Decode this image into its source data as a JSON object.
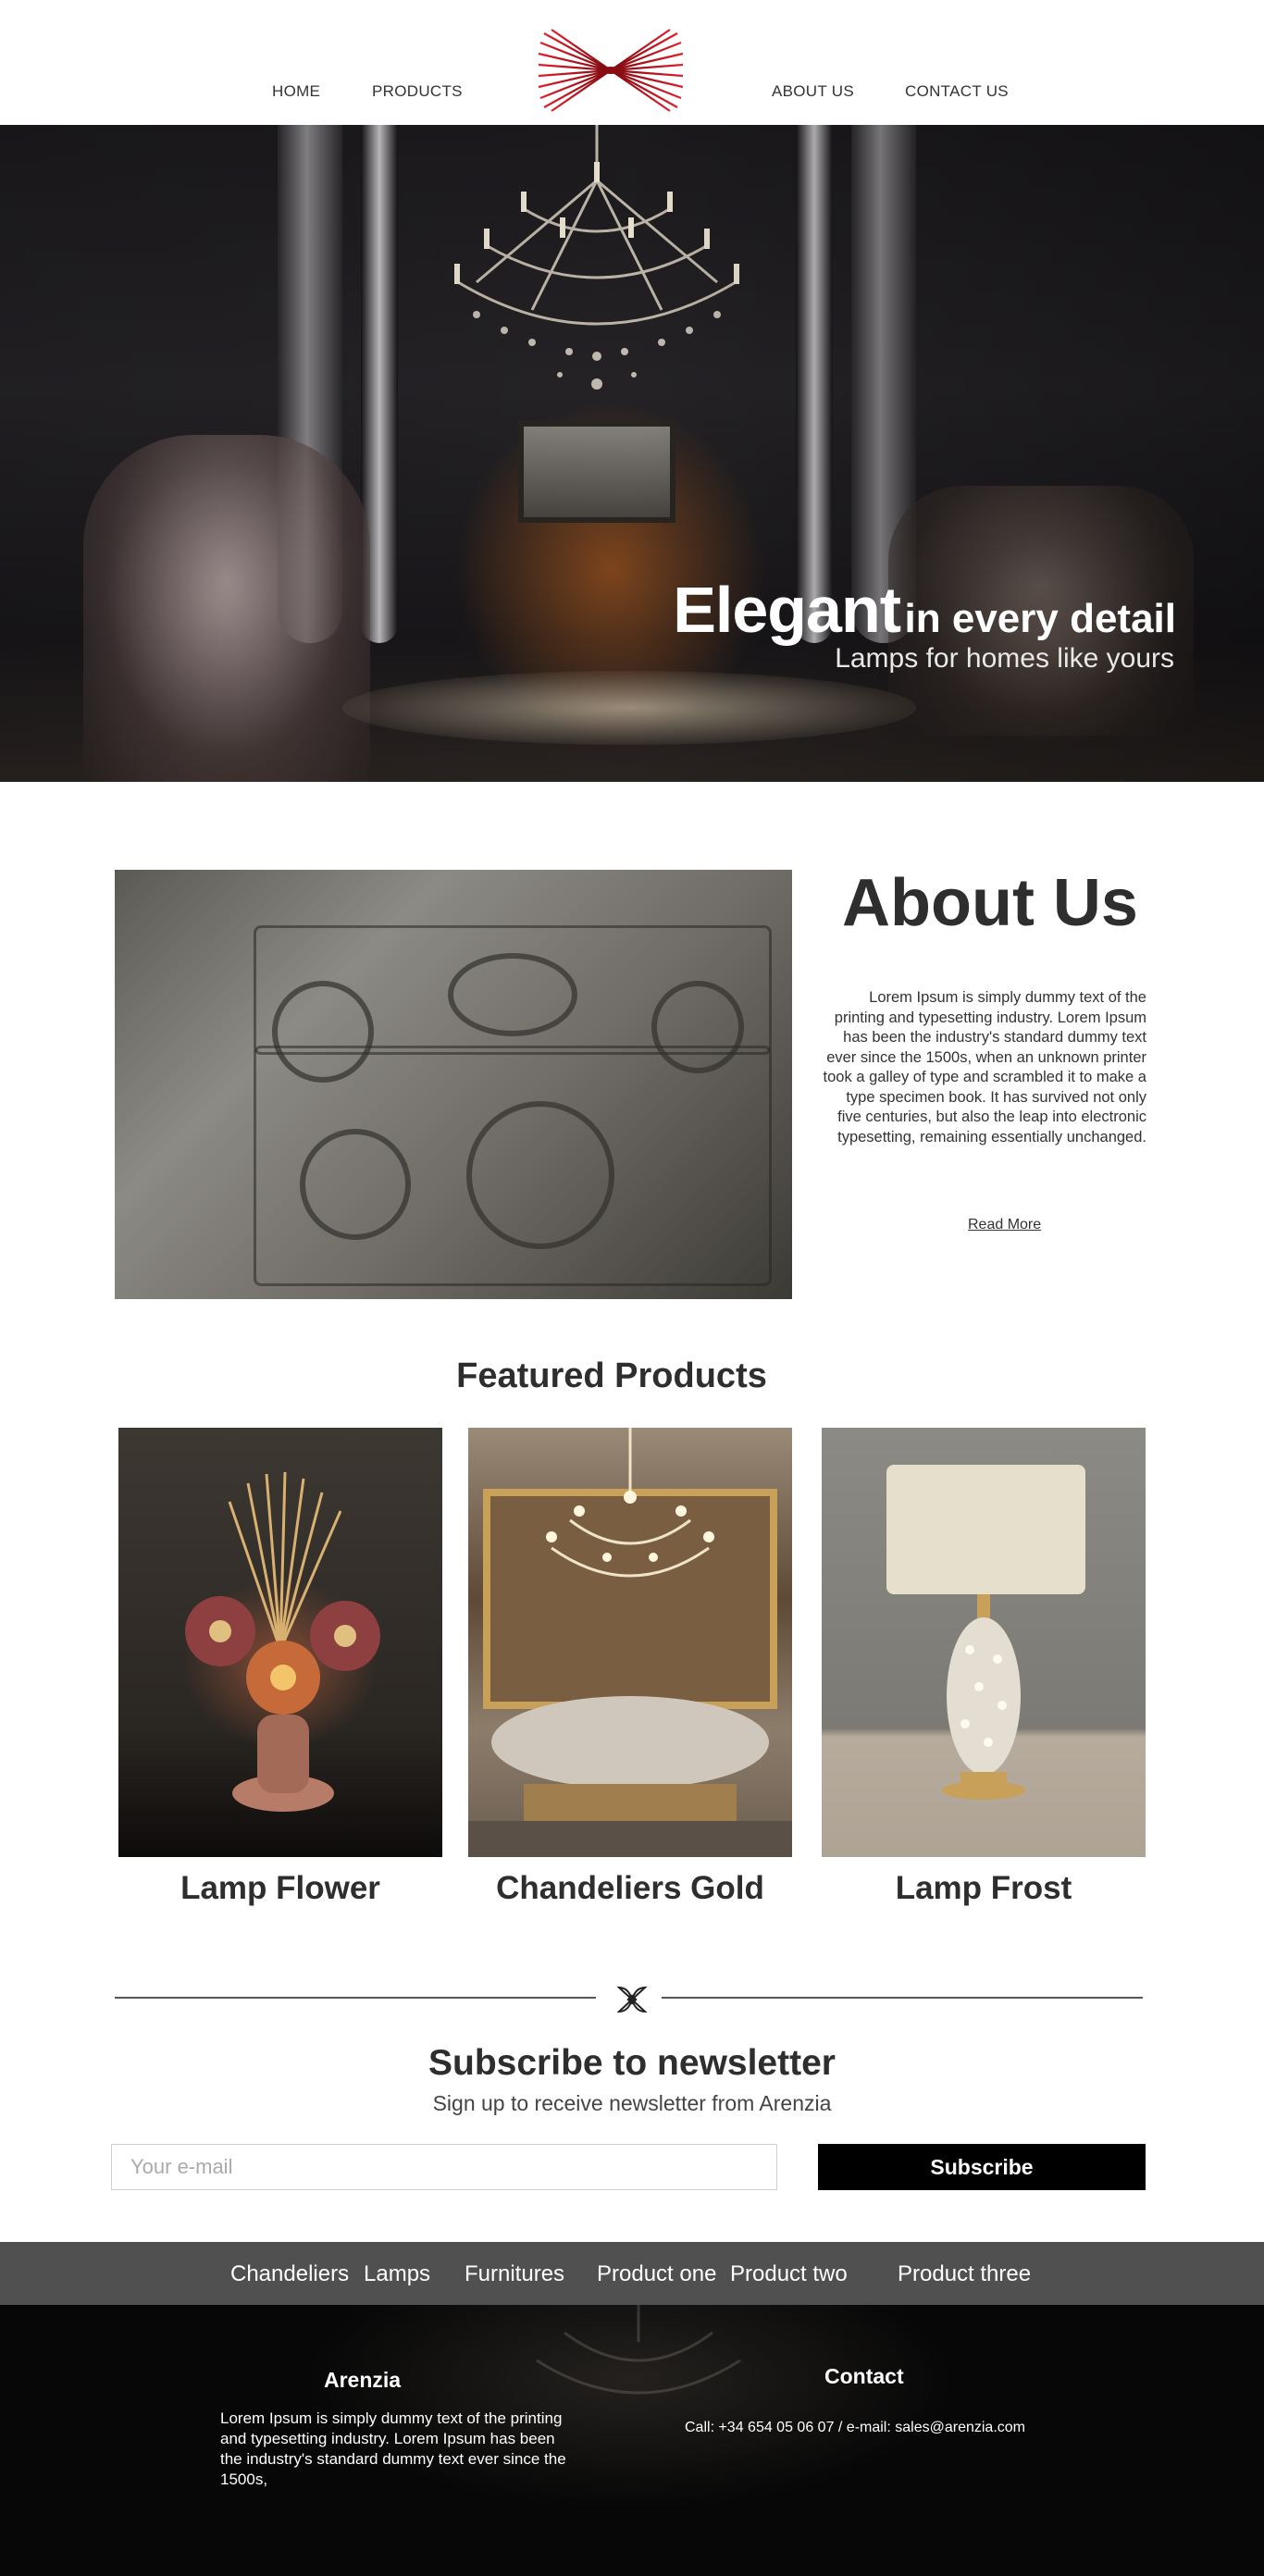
{
  "header": {
    "nav_left": [
      "HOME",
      "PRODUCTS"
    ],
    "nav_right": [
      "ABOUT US",
      "CONTACT US"
    ],
    "logo_icon": "bow-tie-rays-logo",
    "logo_color": "#c0121e"
  },
  "hero": {
    "title_big": "Elegant",
    "title_small": "in every detail",
    "subtitle": "Lamps for homes like yours"
  },
  "about": {
    "title": "About Us",
    "text": "Lorem Ipsum is simply dummy text of the printing and typesetting industry. Lorem Ipsum has been the industry's standard dummy text ever since the 1500s, when an unknown printer took a galley of type and scrambled it to make a type specimen book. It has survived not only five centuries, but also the leap into electronic typesetting, remaining essentially unchanged.",
    "read_more": "Read More"
  },
  "featured": {
    "title": "Featured Products",
    "products": [
      {
        "name": "Lamp Flower"
      },
      {
        "name": "Chandeliers Gold"
      },
      {
        "name": "Lamp Frost"
      }
    ]
  },
  "newsletter": {
    "divider_icon": "ornament-icon",
    "title": "Subscribe to newsletter",
    "subtitle": "Sign up to receive newsletter from Arenzia",
    "email_placeholder": "Your e-mail",
    "button": "Subscribe"
  },
  "categories": [
    "Chandeliers",
    "Lamps",
    "Furnitures",
    "Product one",
    "Product two",
    "Product three"
  ],
  "footer": {
    "brand": "Arenzia",
    "text": "Lorem Ipsum is simply dummy text of the printing and typesetting industry. Lorem Ipsum has been the industry's standard dummy text ever since the 1500s,",
    "contact_title": "Contact",
    "contact_line": "Call: +34 654 05 06 07  / e-mail: sales@arenzia.com"
  },
  "colors": {
    "accent": "#c0121e",
    "dark_text": "#2e2e2e",
    "category_bar": "#505050",
    "footer_bg": "#070707",
    "button_bg": "#000000"
  }
}
